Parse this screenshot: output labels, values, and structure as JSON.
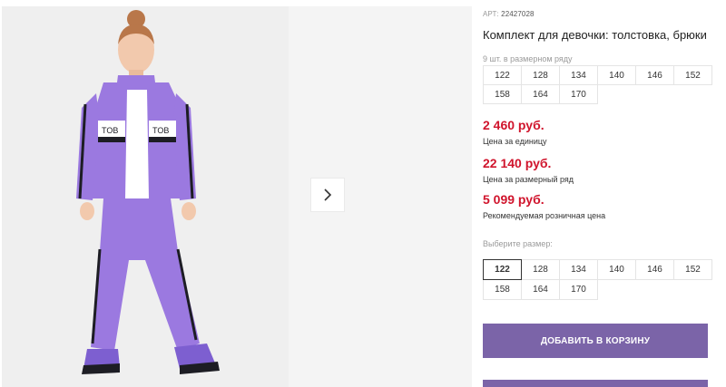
{
  "gallery": {
    "next_arrow_icon": "chevron-right-icon",
    "colors": {
      "suit": "#9b79e0",
      "stripe_dark": "#1d1d24",
      "background": "#efefef"
    }
  },
  "product": {
    "article_label": "АРТ:",
    "article_code": "22427028",
    "title": "Комплект для девочки: толстовка, брюки",
    "pack_note": "9 шт. в размерном ряду",
    "pack_sizes": [
      "122",
      "128",
      "134",
      "140",
      "146",
      "152",
      "158",
      "164",
      "170"
    ]
  },
  "prices": [
    {
      "value": "2 460 руб.",
      "label": "Цена за единицу"
    },
    {
      "value": "22 140 руб.",
      "label": "Цена за размерный ряд"
    },
    {
      "value": "5 099 руб.",
      "label": "Рекомендуемая розничная цена"
    }
  ],
  "size_picker": {
    "label": "Выберите размер:",
    "selected": "122",
    "sizes": [
      "122",
      "128",
      "134",
      "140",
      "146",
      "152",
      "158",
      "164",
      "170"
    ]
  },
  "actions": {
    "add_to_cart": "ДОБАВИТЬ В КОРЗИНУ"
  },
  "theme": {
    "accent": "#7b64a8",
    "price": "#d0142c"
  }
}
